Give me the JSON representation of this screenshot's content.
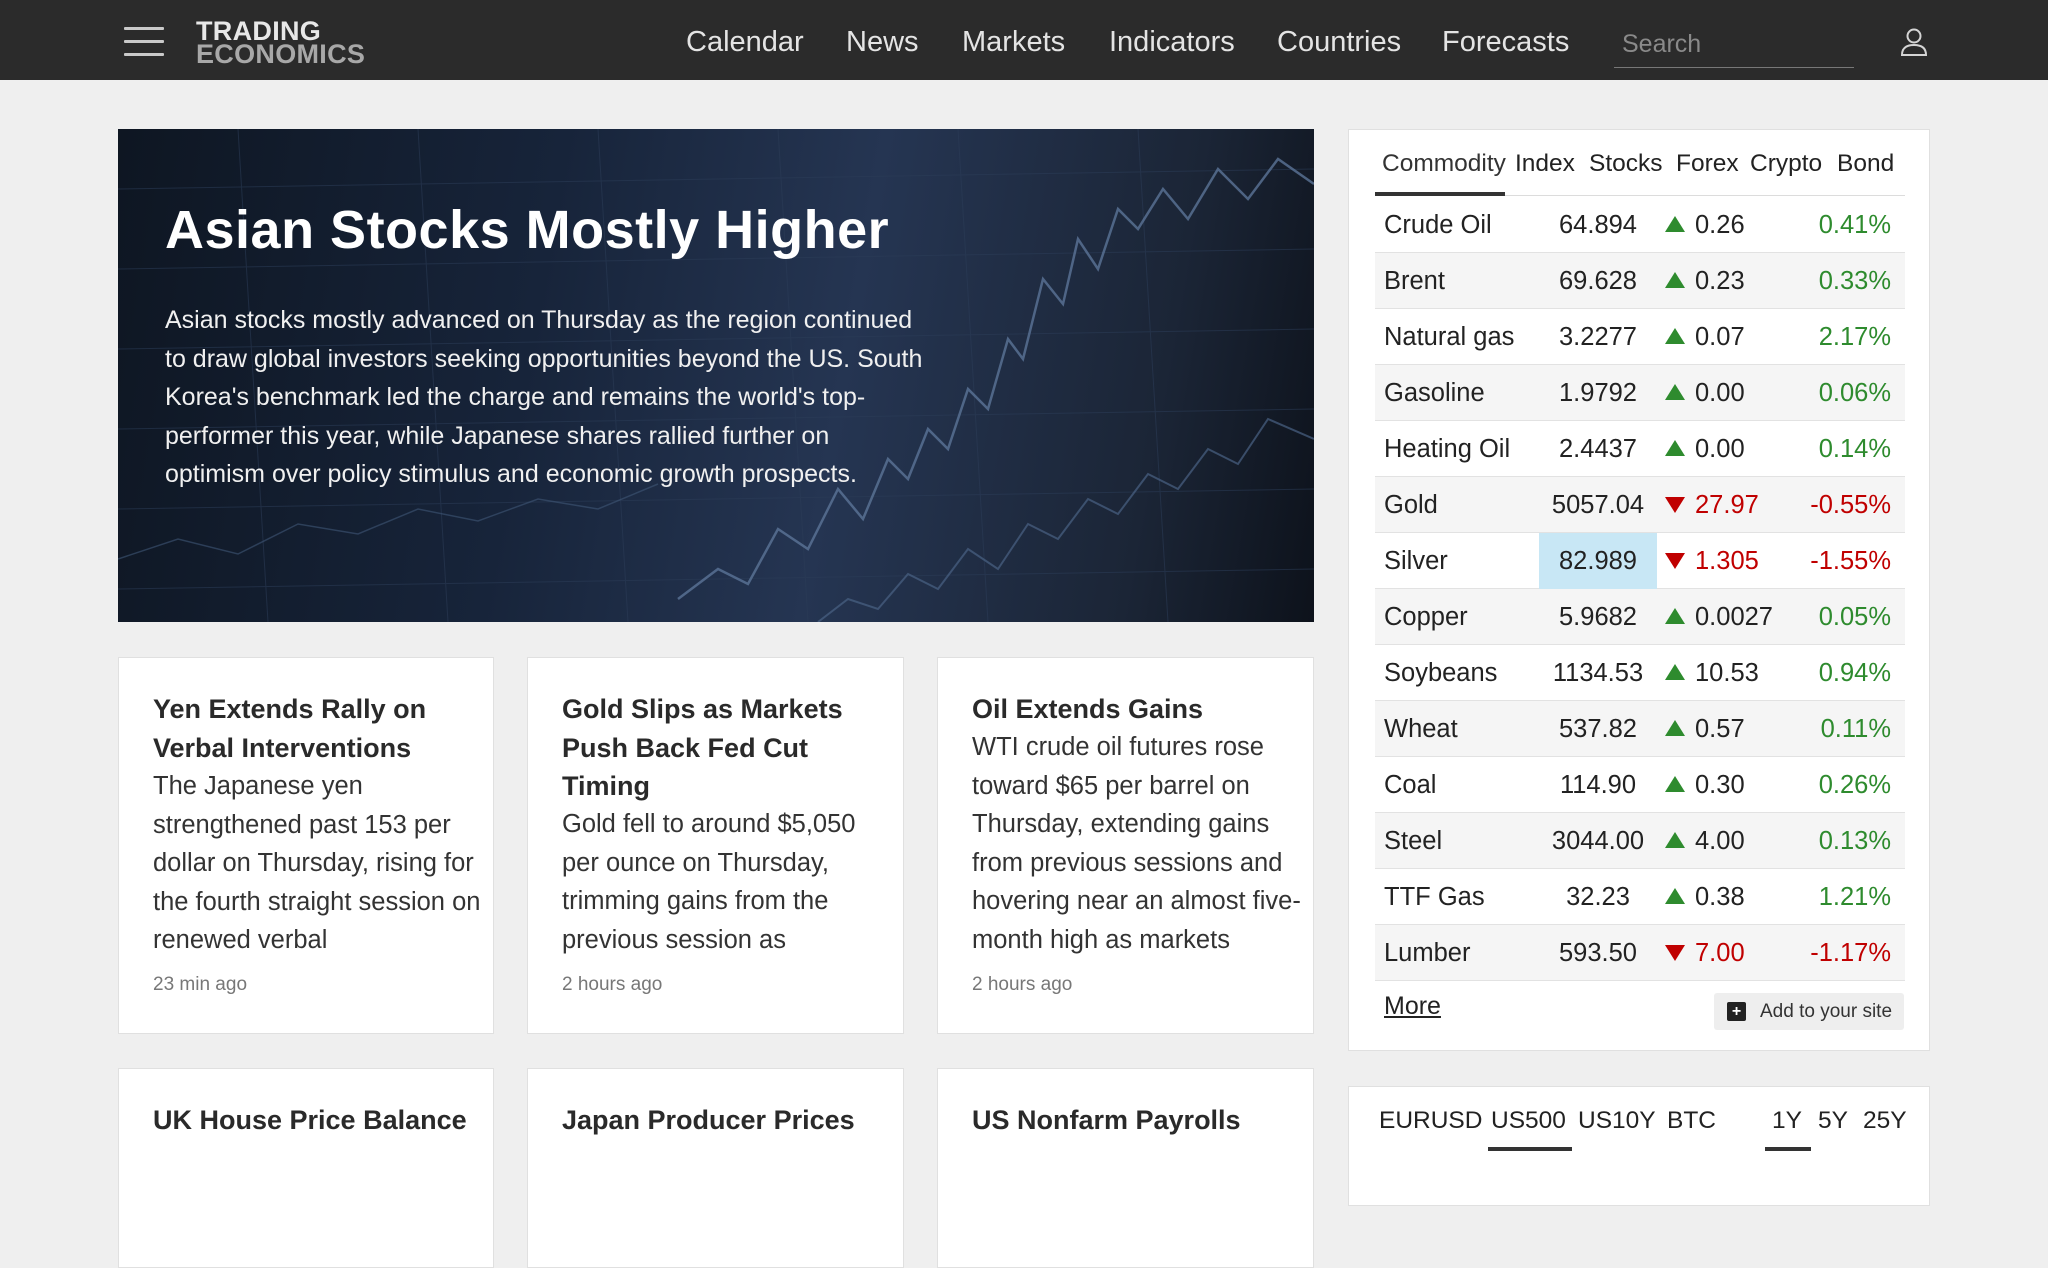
{
  "header": {
    "logo_line1": "TRADING",
    "logo_line2": "ECONOMICS",
    "nav": [
      "Calendar",
      "News",
      "Markets",
      "Indicators",
      "Countries",
      "Forecasts"
    ],
    "search_placeholder": "Search"
  },
  "hero": {
    "title": "Asian Stocks Mostly Higher",
    "text": "Asian stocks mostly advanced on Thursday as the region continued to draw global investors seeking opportunities beyond the US. South Korea's benchmark led the charge and remains the world's top-performer this year, while Japanese shares rallied further on optimism over policy stimulus and economic growth prospects."
  },
  "cards": [
    {
      "title": "Yen Extends Rally on Verbal Interventions",
      "body": "The Japanese yen strengthened past 153 per dollar on Thursday, rising for the fourth straight session on renewed verbal",
      "time": "23 min ago"
    },
    {
      "title": "Gold Slips as Markets Push Back Fed Cut Timing",
      "body": "Gold fell to around $5,050 per ounce on Thursday, trimming gains from the previous session as",
      "time": "2 hours ago"
    },
    {
      "title": "Oil Extends Gains",
      "body": "WTI crude oil futures rose toward $65 per barrel on Thursday, extending gains from previous sessions and hovering near an almost five-month high as markets",
      "time": "2 hours ago"
    },
    {
      "title": "UK House Price Balance"
    },
    {
      "title": "Japan Producer Prices"
    },
    {
      "title": "US Nonfarm Payrolls"
    }
  ],
  "markets": {
    "tabs": [
      "Commodity",
      "Index",
      "Stocks",
      "Forex",
      "Crypto",
      "Bond"
    ],
    "active_tab": "Commodity",
    "rows": [
      {
        "name": "Crude Oil",
        "price": "64.894",
        "change": "0.26",
        "pct": "0.41%",
        "dir": "up"
      },
      {
        "name": "Brent",
        "price": "69.628",
        "change": "0.23",
        "pct": "0.33%",
        "dir": "up"
      },
      {
        "name": "Natural gas",
        "price": "3.2277",
        "change": "0.07",
        "pct": "2.17%",
        "dir": "up"
      },
      {
        "name": "Gasoline",
        "price": "1.9792",
        "change": "0.00",
        "pct": "0.06%",
        "dir": "up"
      },
      {
        "name": "Heating Oil",
        "price": "2.4437",
        "change": "0.00",
        "pct": "0.14%",
        "dir": "up"
      },
      {
        "name": "Gold",
        "price": "5057.04",
        "change": "27.97",
        "pct": "-0.55%",
        "dir": "down"
      },
      {
        "name": "Silver",
        "price": "82.989",
        "change": "1.305",
        "pct": "-1.55%",
        "dir": "down",
        "highlight": true
      },
      {
        "name": "Copper",
        "price": "5.9682",
        "change": "0.0027",
        "pct": "0.05%",
        "dir": "up"
      },
      {
        "name": "Soybeans",
        "price": "1134.53",
        "change": "10.53",
        "pct": "0.94%",
        "dir": "up"
      },
      {
        "name": "Wheat",
        "price": "537.82",
        "change": "0.57",
        "pct": "0.11%",
        "dir": "up"
      },
      {
        "name": "Coal",
        "price": "114.90",
        "change": "0.30",
        "pct": "0.26%",
        "dir": "up"
      },
      {
        "name": "Steel",
        "price": "3044.00",
        "change": "4.00",
        "pct": "0.13%",
        "dir": "up"
      },
      {
        "name": "TTF Gas",
        "price": "32.23",
        "change": "0.38",
        "pct": "1.21%",
        "dir": "up"
      },
      {
        "name": "Lumber",
        "price": "593.50",
        "change": "7.00",
        "pct": "-1.17%",
        "dir": "down"
      }
    ],
    "more_label": "More",
    "add_label": "Add to your site",
    "colors": {
      "up": "#2e8b2e",
      "down": "#c00000",
      "highlight": "#c8e7f5"
    }
  },
  "chart_widget": {
    "tabs": [
      "EURUSD",
      "US500",
      "US10Y",
      "BTC"
    ],
    "active_tab": "US500",
    "ranges": [
      "1Y",
      "5Y",
      "25Y"
    ],
    "active_range": "1Y"
  }
}
